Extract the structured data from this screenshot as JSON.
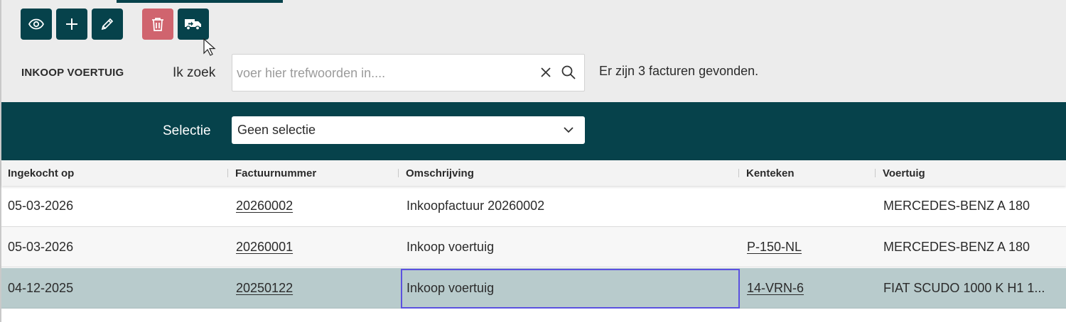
{
  "toolbar": {
    "buttons": [
      {
        "name": "view",
        "icon": "eye-icon"
      },
      {
        "name": "add",
        "icon": "plus-icon"
      },
      {
        "name": "edit",
        "icon": "pencil-icon"
      },
      {
        "name": "delete",
        "icon": "trash-icon"
      },
      {
        "name": "vehicle",
        "icon": "truck-icon"
      }
    ]
  },
  "header": {
    "module_title": "INKOOP VOERTUIG",
    "search_label": "Ik zoek",
    "search_placeholder": "voer hier trefwoorden in....",
    "search_value": "",
    "result_text": "Er zijn 3 facturen gevonden."
  },
  "filter": {
    "label": "Selectie",
    "selected": "Geen selectie"
  },
  "table": {
    "columns": [
      "Ingekocht op",
      "Factuurnummer",
      "Omschrijving",
      "Kenteken",
      "Voertuig"
    ],
    "rows": [
      {
        "date": "05-03-2026",
        "invoice": "20260002",
        "description": "Inkoopfactuur 20260002",
        "plate": "",
        "vehicle": "MERCEDES-BENZ A 180"
      },
      {
        "date": "05-03-2026",
        "invoice": "20260001",
        "description": "Inkoop voertuig",
        "plate": "P-150-NL",
        "vehicle": "MERCEDES-BENZ A 180"
      },
      {
        "date": "04-12-2025",
        "invoice": "20250122",
        "description": "Inkoop voertuig",
        "plate": "14-VRN-6",
        "vehicle": "FIAT SCUDO 1000 K H1 1..."
      }
    ]
  },
  "colors": {
    "primary": "#06424b",
    "danger": "#d0646e",
    "selected_row": "#b8cbcc",
    "focus": "#5b51e0"
  }
}
